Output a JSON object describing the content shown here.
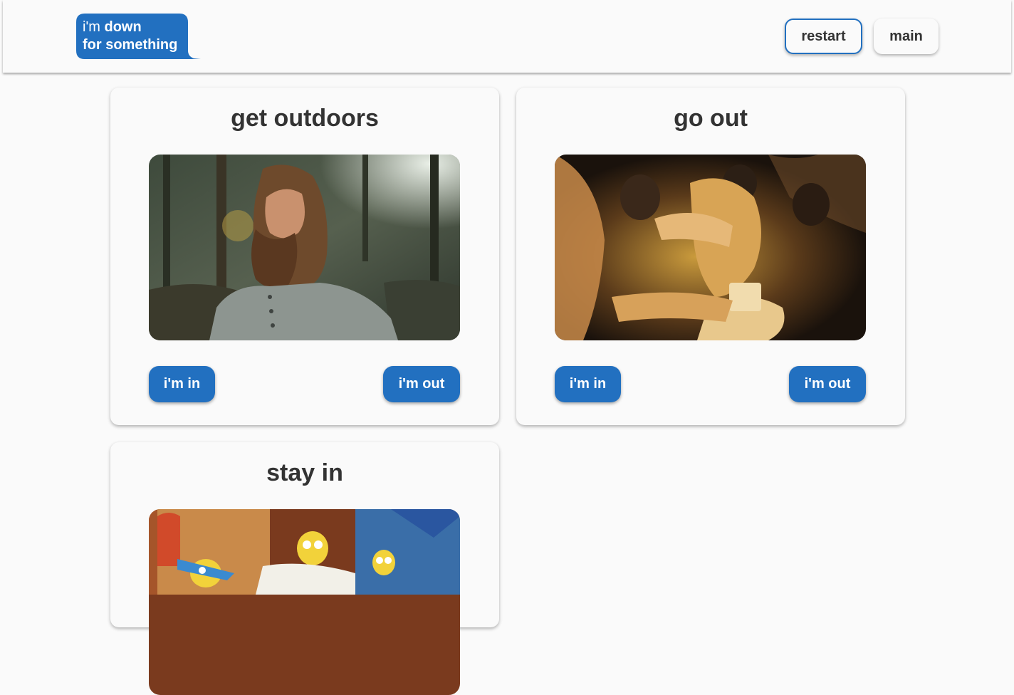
{
  "header": {
    "logo": {
      "line1_light": "i'm ",
      "line1_bold": "down",
      "line2": "for something"
    },
    "buttons": {
      "restart": "restart",
      "main": "main"
    }
  },
  "cards": [
    {
      "title": "get outdoors",
      "image": "bearded-man-forest-photo",
      "in_label": "i'm in",
      "out_label": "i'm out"
    },
    {
      "title": "go out",
      "image": "dancing-party-photo",
      "in_label": "i'm in",
      "out_label": "i'm out"
    },
    {
      "title": "stay in",
      "image": "cartoon-family-couch-image"
    }
  ],
  "colors": {
    "accent": "#2270c0",
    "background": "#fafafa",
    "text": "#333333"
  }
}
